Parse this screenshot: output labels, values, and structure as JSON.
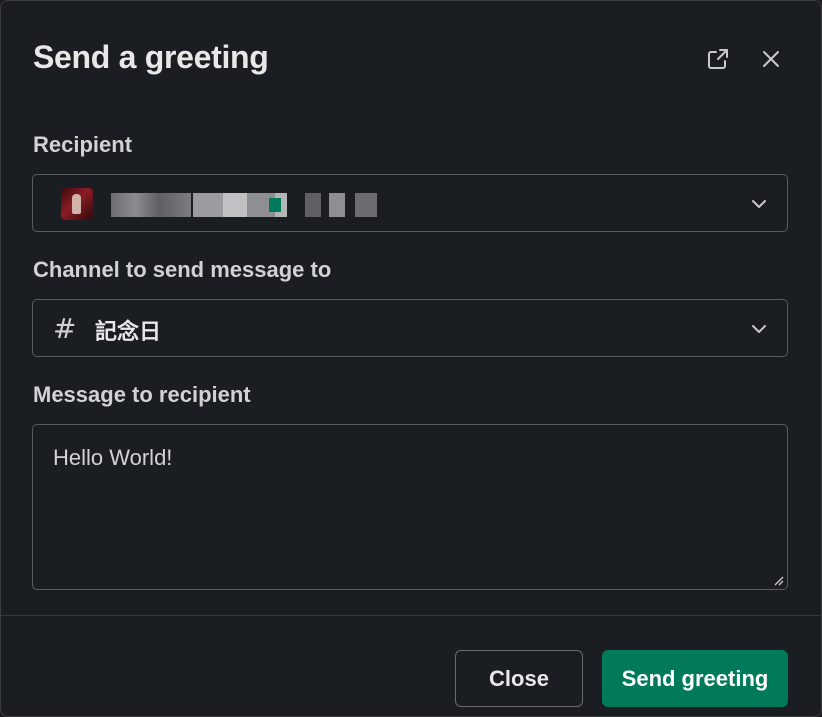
{
  "dialog": {
    "title": "Send a greeting",
    "popout_icon": "external-link-icon",
    "close_icon": "close-icon"
  },
  "recipient": {
    "label": "Recipient",
    "value": "",
    "avatar": "user-avatar",
    "chevron_icon": "chevron-down-icon"
  },
  "channel": {
    "label": "Channel to send message to",
    "prefix": "#",
    "value": "記念日",
    "chevron_icon": "chevron-down-icon"
  },
  "message": {
    "label": "Message to recipient",
    "value": "Hello World!"
  },
  "footer": {
    "close_label": "Close",
    "send_label": "Send greeting"
  },
  "colors": {
    "background": "#1a1d21",
    "primary_button": "#007a5a",
    "border": "#5a5c60",
    "text": "#d1d2d3"
  }
}
